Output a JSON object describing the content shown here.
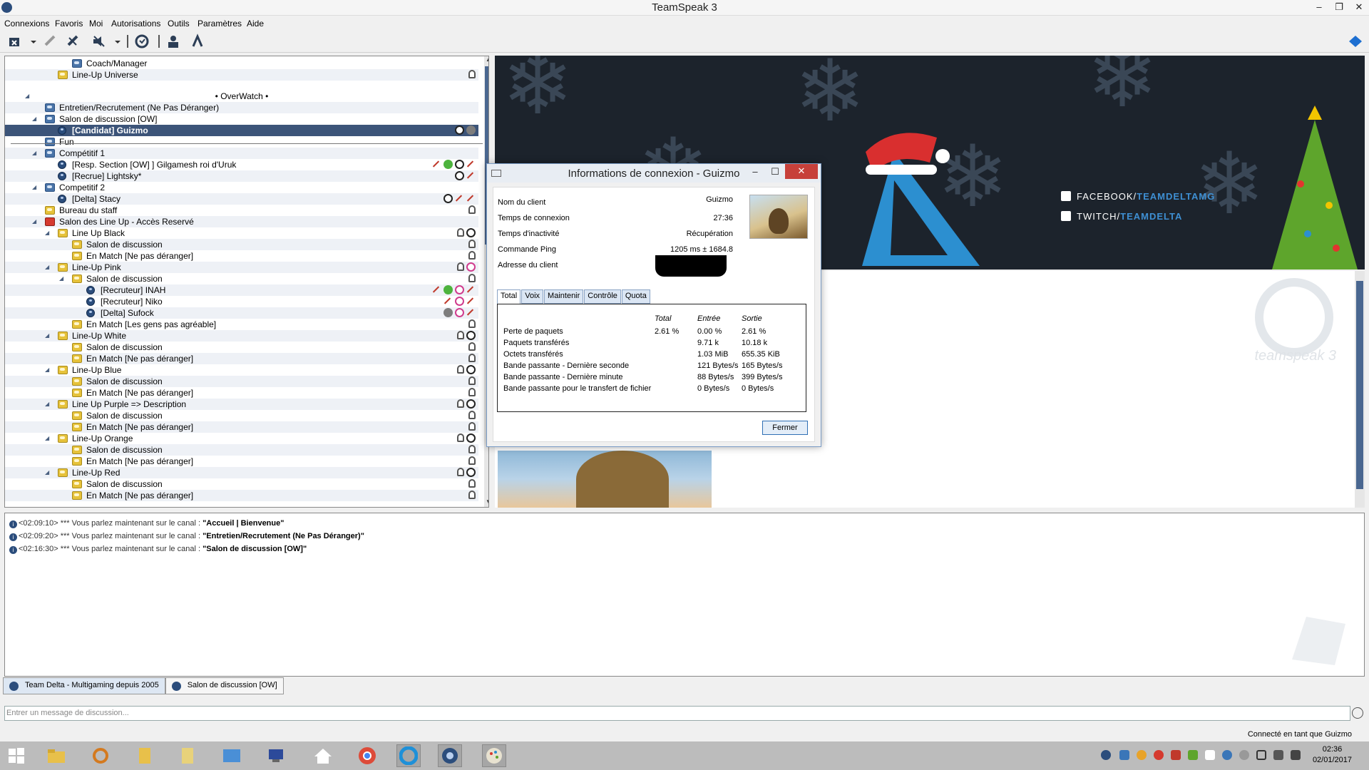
{
  "window": {
    "title": "TeamSpeak 3"
  },
  "menu": [
    "Connexions",
    "Favoris",
    "Moi",
    "Autorisations",
    "Outils",
    "Paramètres",
    "Aide"
  ],
  "tree": {
    "rows": [
      {
        "label": "Coach/Manager",
        "type": "ch",
        "indent": 3
      },
      {
        "label": "Line-Up Universe",
        "type": "lock",
        "indent": 2
      },
      {
        "label": "• OverWatch •",
        "type": "spacer",
        "indent": 0
      },
      {
        "label": "Entretien/Recrutement (Ne Pas Déranger)",
        "type": "ch",
        "indent": 1
      },
      {
        "label": "Salon de discussion [OW]",
        "type": "ch",
        "indent": 1
      },
      {
        "label": "[Candidat] Guizmo",
        "type": "user",
        "indent": 2,
        "selected": true
      },
      {
        "label": "Fun",
        "type": "ch",
        "indent": 1
      },
      {
        "label": "Compétitif 1",
        "type": "ch",
        "indent": 1
      },
      {
        "label": "[Resp. Section [OW] ] Gilgamesh roi d'Uruk",
        "type": "user",
        "indent": 2
      },
      {
        "label": "[Recrue] Lightsky*",
        "type": "user",
        "indent": 2
      },
      {
        "label": "Competitif 2",
        "type": "ch",
        "indent": 1
      },
      {
        "label": "[Delta] Stacy",
        "type": "user",
        "indent": 2
      },
      {
        "label": "Bureau du staff",
        "type": "lock",
        "indent": 1
      },
      {
        "label": "Salon des Line Up - Accès Reservé",
        "type": "red",
        "indent": 1
      },
      {
        "label": "Line Up Black",
        "type": "lock",
        "indent": 2
      },
      {
        "label": "Salon de discussion",
        "type": "lock",
        "indent": 3
      },
      {
        "label": "En Match [Ne pas déranger]",
        "type": "lock",
        "indent": 3
      },
      {
        "label": "Line-Up Pink",
        "type": "lock",
        "indent": 2
      },
      {
        "label": "Salon de discussion",
        "type": "lock",
        "indent": 3
      },
      {
        "label": "[Recruteur] INAH",
        "type": "user",
        "indent": 4
      },
      {
        "label": "[Recruteur] Niko",
        "type": "user",
        "indent": 4
      },
      {
        "label": "[Delta] Sufock",
        "type": "user",
        "indent": 4
      },
      {
        "label": "En Match [Les gens pas agréable]",
        "type": "lock",
        "indent": 3
      },
      {
        "label": "Line-Up White",
        "type": "lock",
        "indent": 2
      },
      {
        "label": "Salon de discussion",
        "type": "lock",
        "indent": 3
      },
      {
        "label": "En Match [Ne pas déranger]",
        "type": "lock",
        "indent": 3
      },
      {
        "label": "Line-Up Blue",
        "type": "lock",
        "indent": 2
      },
      {
        "label": "Salon de discussion",
        "type": "lock",
        "indent": 3
      },
      {
        "label": "En Match [Ne pas déranger]",
        "type": "lock",
        "indent": 3
      },
      {
        "label": "Line Up Purple => Description",
        "type": "lock",
        "indent": 2
      },
      {
        "label": "Salon de discussion",
        "type": "lock",
        "indent": 3
      },
      {
        "label": "En Match [Ne pas déranger]",
        "type": "lock",
        "indent": 3
      },
      {
        "label": "Line-Up Orange",
        "type": "lock",
        "indent": 2
      },
      {
        "label": "Salon de discussion",
        "type": "lock",
        "indent": 3
      },
      {
        "label": "En Match [Ne pas déranger]",
        "type": "lock",
        "indent": 3
      },
      {
        "label": "Line-Up Red",
        "type": "lock",
        "indent": 2
      },
      {
        "label": "Salon de discussion",
        "type": "lock",
        "indent": 3
      },
      {
        "label": "En Match [Ne pas déranger]",
        "type": "lock",
        "indent": 3
      }
    ]
  },
  "banner": {
    "facebook_prefix": "FACEBOOK/",
    "facebook_handle": "TEAMDELTAMG",
    "twitch_prefix": "TWITCH/",
    "twitch_handle": "TEAMDELTA"
  },
  "infopane": {
    "logo_text": "teamspeak 3"
  },
  "dialog": {
    "title": "Informations de connexion - Guizmo",
    "fields": [
      {
        "key": "Nom du client",
        "value": "Guizmo"
      },
      {
        "key": "Temps de connexion",
        "value": "27:36"
      },
      {
        "key": "Temps d'inactivité",
        "value": "Récupération"
      },
      {
        "key": "Commande Ping",
        "value": "1205 ms ± 1684.8"
      },
      {
        "key": "Adresse du client",
        "value": ""
      }
    ],
    "tabs": [
      "Total",
      "Voix",
      "Maintenir",
      "Contrôle",
      "Quota"
    ],
    "headers": [
      "Total",
      "Entrée",
      "Sortie"
    ],
    "stats": [
      {
        "label": "Perte de paquets",
        "total": "2.61 %",
        "in": "0.00 %",
        "out": "2.61 %"
      },
      {
        "label": "Paquets transférés",
        "total": "",
        "in": "9.71 k",
        "out": "10.18 k"
      },
      {
        "label": "Octets transférés",
        "total": "",
        "in": "1.03 MiB",
        "out": "655.35 KiB"
      },
      {
        "label": "Bande passante - Dernière seconde",
        "total": "",
        "in": "121 Bytes/s",
        "out": "165 Bytes/s"
      },
      {
        "label": "Bande passante - Dernière minute",
        "total": "",
        "in": "88 Bytes/s",
        "out": "399 Bytes/s"
      },
      {
        "label": "Bande passante pour le transfert de fichier",
        "total": "",
        "in": "0 Bytes/s",
        "out": "0 Bytes/s"
      }
    ],
    "close_label": "Fermer"
  },
  "chat": {
    "lines": [
      {
        "time": "<02:09:10>",
        "text": " *** Vous parlez maintenant sur le canal : ",
        "channel": "\"Accueil | Bienvenue\""
      },
      {
        "time": "<02:09:20>",
        "text": " *** Vous parlez maintenant sur le canal : ",
        "channel": "\"Entretien/Recrutement (Ne Pas Déranger)\""
      },
      {
        "time": "<02:16:30>",
        "text": " *** Vous parlez maintenant sur le canal : ",
        "channel": "\"Salon de discussion [OW]\""
      }
    ],
    "tabs": [
      "Team Delta - Multigaming depuis 2005",
      "Salon de discussion [OW]"
    ],
    "input_placeholder": "Entrer un message de discussion...",
    "status": "Connecté en tant que Guizmo"
  },
  "taskbar": {
    "time": "02:36",
    "date": "02/01/2017"
  }
}
